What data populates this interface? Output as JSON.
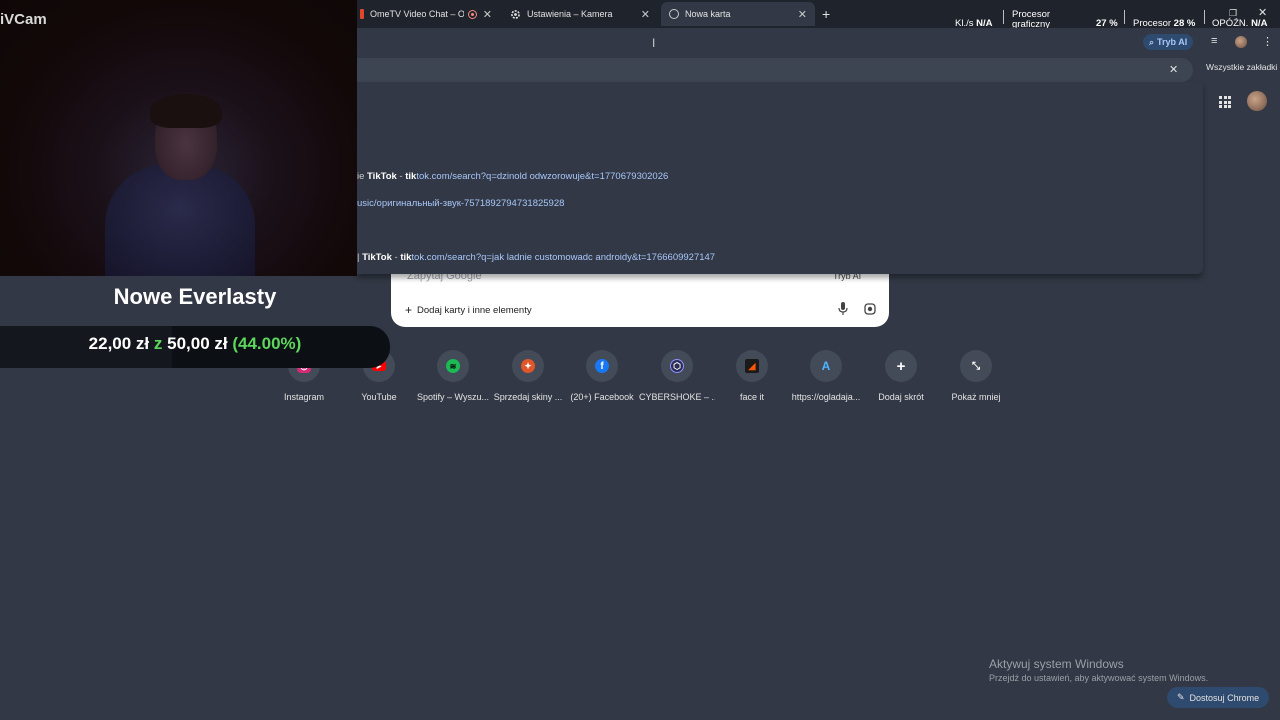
{
  "webcam": {
    "app_label": "iVCam"
  },
  "goal": {
    "title": "Nowe Everlasty",
    "current": "22,00 zł",
    "separator": "z",
    "target": "50,00 zł",
    "percent_text": "(44.00%)",
    "progress": 0.44
  },
  "tabs": [
    {
      "title": "OmeTV Video Chat – Ome",
      "recording": true
    },
    {
      "title": "Ustawienia – Kamera"
    },
    {
      "title": "Nowa karta",
      "active": true
    }
  ],
  "perf_overlay": {
    "kls_label": "Kl./s",
    "kls_value": "N/A",
    "gpu_label_1": "Procesor",
    "gpu_label_2": "graficzny",
    "gpu_value": "27 %",
    "cpu_label": "Procesor",
    "cpu_value": "28 %",
    "latency_label": "OPÓŹN.",
    "latency_value": "N/A"
  },
  "toolbar": {
    "ai_mode": "Tryb AI"
  },
  "bookmarks": {
    "all_bookmarks": "Wszystkie zakładki"
  },
  "suggestions": [
    {
      "prefix": "ie ",
      "site": "TikTok",
      "dash": " - ",
      "url_bold": "tik",
      "url_rest": "tok.com/search?q=dzinold odwzorowuje&t=1770679302026"
    },
    {
      "prefix": "",
      "site": "",
      "dash": "",
      "url_bold": "",
      "url_rest": "usic/оригинальный-звук-7571892794731825928"
    },
    {
      "prefix": "| ",
      "site": "TikTok",
      "dash": " - ",
      "url_bold": "tik",
      "url_rest": "tok.com/search?q=jak ladnie customowadc androidy&t=1766609927147"
    }
  ],
  "search_box": {
    "placeholder": "Zapytaj Google",
    "ai_mode": "Tryb AI",
    "add_label": "Dodaj karty i inne elementy"
  },
  "shortcuts": [
    {
      "label": "Instagram",
      "icon": "instagram-icon",
      "color": "#d62976"
    },
    {
      "label": "YouTube",
      "icon": "youtube-icon",
      "color": "#ff0000"
    },
    {
      "label": "Spotify – Wyszu...",
      "icon": "spotify-icon",
      "color": "#1db954"
    },
    {
      "label": "Sprzedaj skiny ...",
      "icon": "skins-icon",
      "color": "#e0562a"
    },
    {
      "label": "(20+) Facebook",
      "icon": "facebook-icon",
      "color": "#1877f2"
    },
    {
      "label": "CYBERSHOKE – ...",
      "icon": "cybershoke-icon",
      "color": "#6b6fd8"
    },
    {
      "label": "face it",
      "icon": "faceit-icon",
      "color": "#ff5500"
    },
    {
      "label": "https://ogladaja...",
      "icon": "site-icon",
      "color": "#4fb3ff"
    },
    {
      "label": "Dodaj skrót",
      "icon": "plus-icon",
      "color": "#434a58"
    },
    {
      "label": "Pokaż mniej",
      "icon": "collapse-icon",
      "color": "#434a58"
    }
  ],
  "windows_activation": {
    "title": "Aktywuj system Windows",
    "subtitle": "Przejdź do ustawień, aby aktywować system Windows."
  },
  "customize_button": "Dostosuj Chrome"
}
